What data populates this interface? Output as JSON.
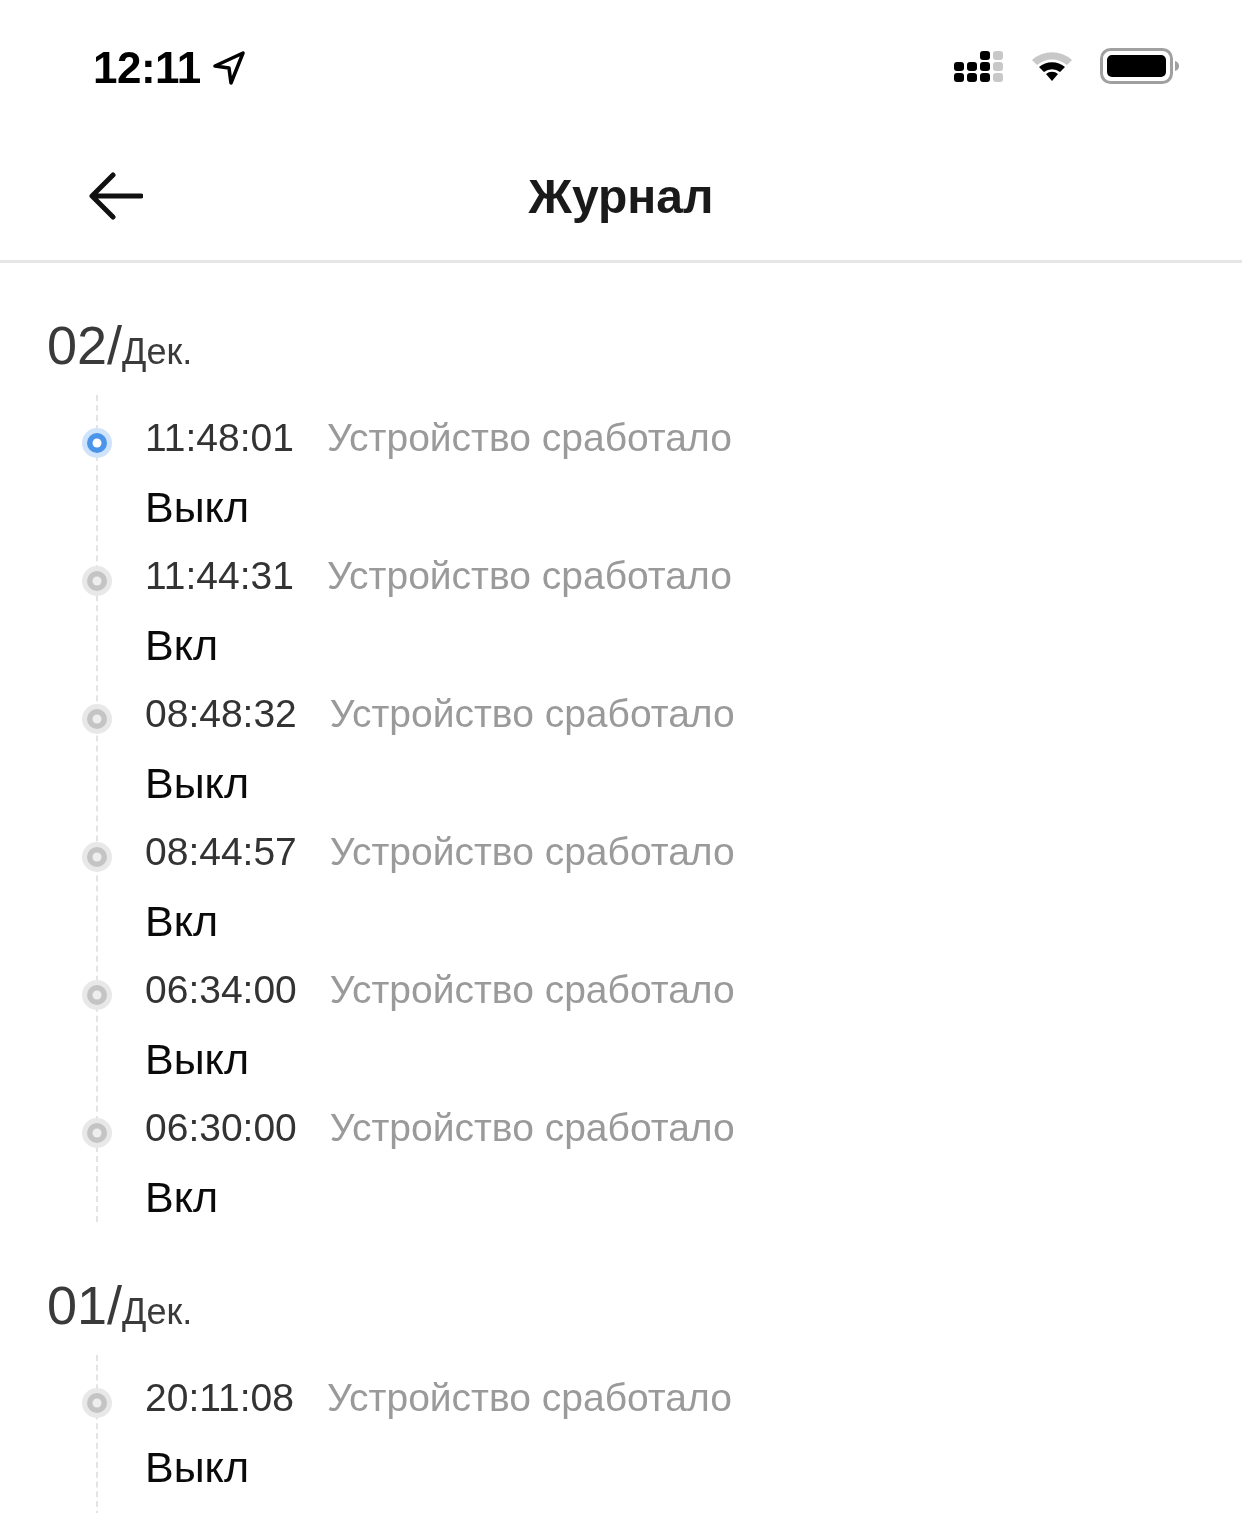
{
  "status_bar": {
    "time": "12:11"
  },
  "header": {
    "title": "Журнал"
  },
  "groups": [
    {
      "day": "02/",
      "month": "Дек.",
      "events": [
        {
          "time": "11:48:01",
          "description": "Устройство сработало",
          "value": "Выкл",
          "active": true
        },
        {
          "time": "11:44:31",
          "description": "Устройство сработало",
          "value": "Вкл",
          "active": false
        },
        {
          "time": "08:48:32",
          "description": "Устройство сработало",
          "value": "Выкл",
          "active": false
        },
        {
          "time": "08:44:57",
          "description": "Устройство сработало",
          "value": "Вкл",
          "active": false
        },
        {
          "time": "06:34:00",
          "description": "Устройство сработало",
          "value": "Выкл",
          "active": false
        },
        {
          "time": "06:30:00",
          "description": "Устройство сработало",
          "value": "Вкл",
          "active": false
        }
      ]
    },
    {
      "day": "01/",
      "month": "Дек.",
      "events": [
        {
          "time": "20:11:08",
          "description": "Устройство сработало",
          "value": "Выкл",
          "active": false
        }
      ]
    }
  ]
}
